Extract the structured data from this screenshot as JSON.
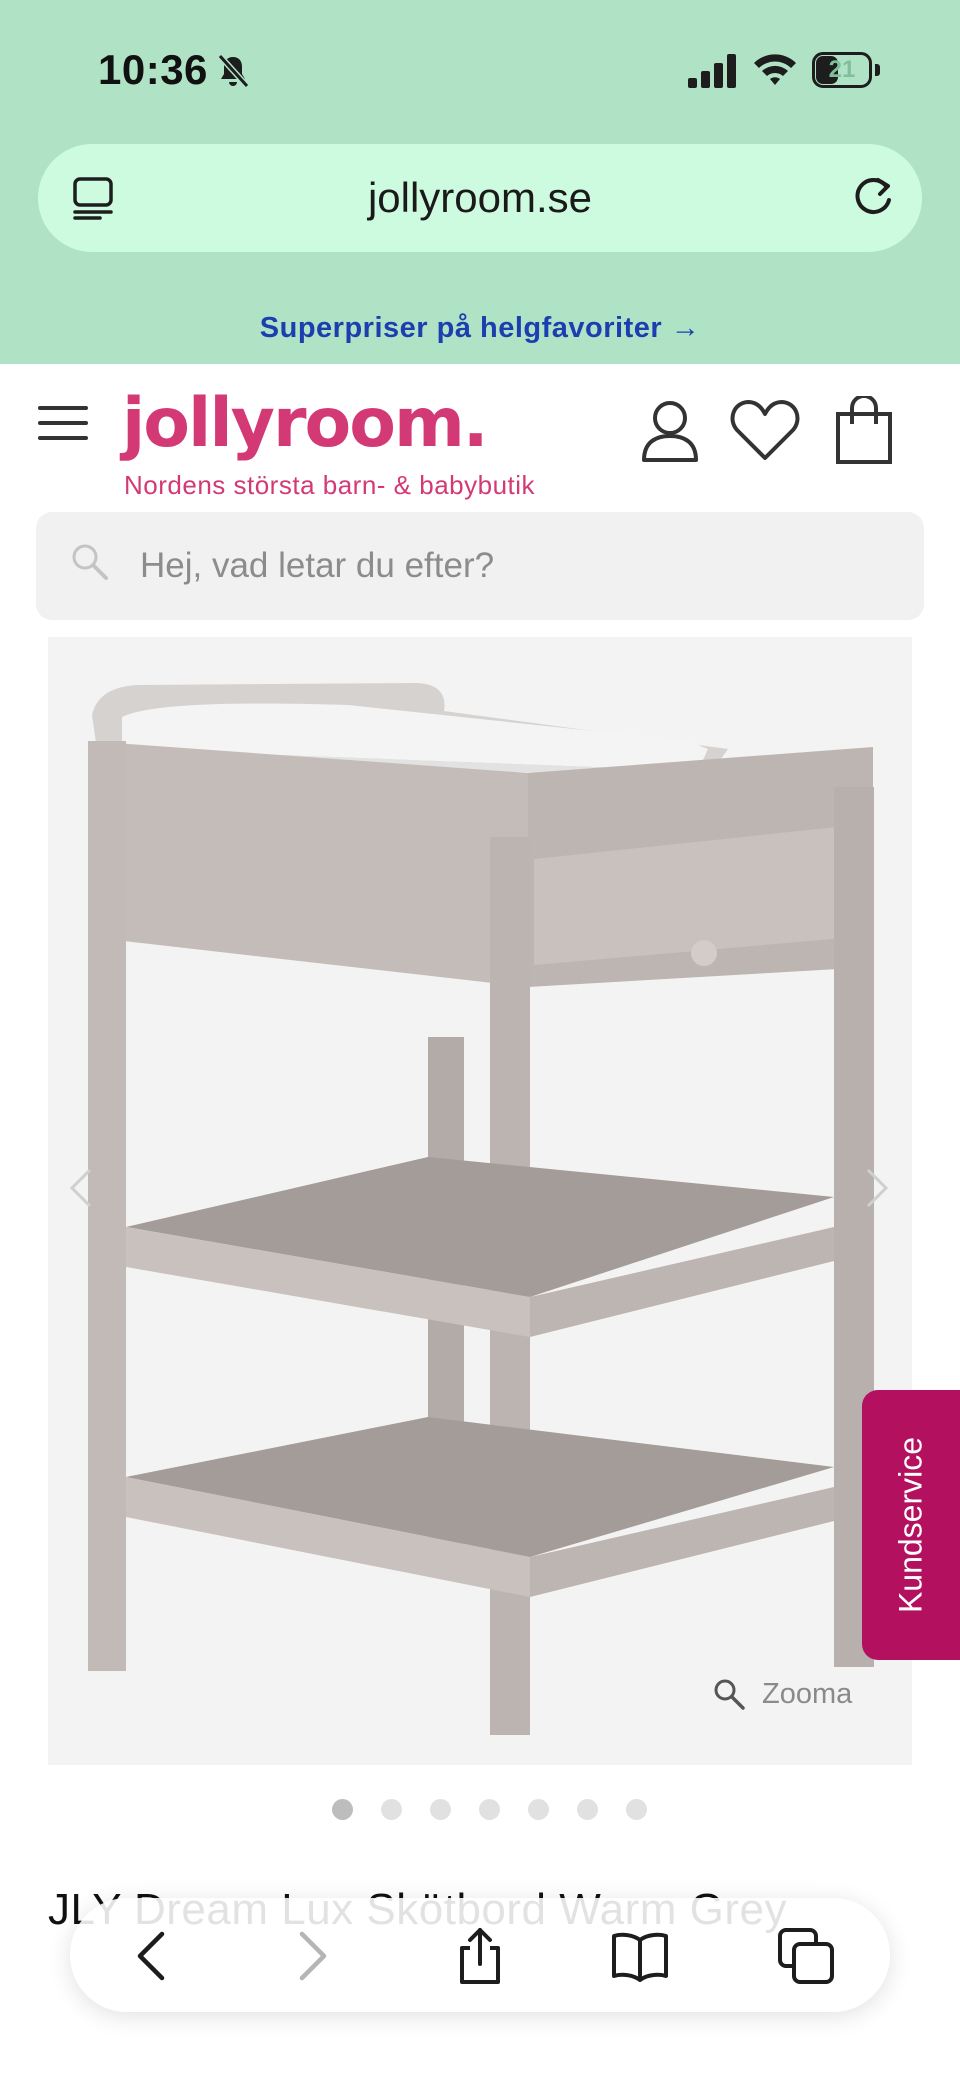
{
  "status_bar": {
    "time": "10:36",
    "battery": "21"
  },
  "browser": {
    "url": "jollyroom.se"
  },
  "promo": {
    "text": "Superpriser på helgfavoriter →"
  },
  "site": {
    "logo": "jollyroom.",
    "tagline": "Nordens största barn- & babybutik",
    "search_placeholder": "Hej, vad letar du efter?",
    "brand_color": "#d33a75"
  },
  "product": {
    "zoom_label": "Zooma",
    "carousel": {
      "total": 7,
      "active": 1
    },
    "title": "JLY Dream Lux Skötbord Warm Grey"
  },
  "support": {
    "label": "Kundservice",
    "color": "#b3105f"
  },
  "icons": [
    "bell-slash-icon",
    "signal-icon",
    "wifi-icon",
    "battery-icon",
    "tabs-icon",
    "reload-icon",
    "menu-icon",
    "user-icon",
    "heart-icon",
    "bag-icon",
    "search-icon",
    "chevron-left-icon",
    "chevron-right-icon",
    "zoom-icon",
    "share-icon",
    "bookmarks-icon",
    "tab-overview-icon"
  ]
}
